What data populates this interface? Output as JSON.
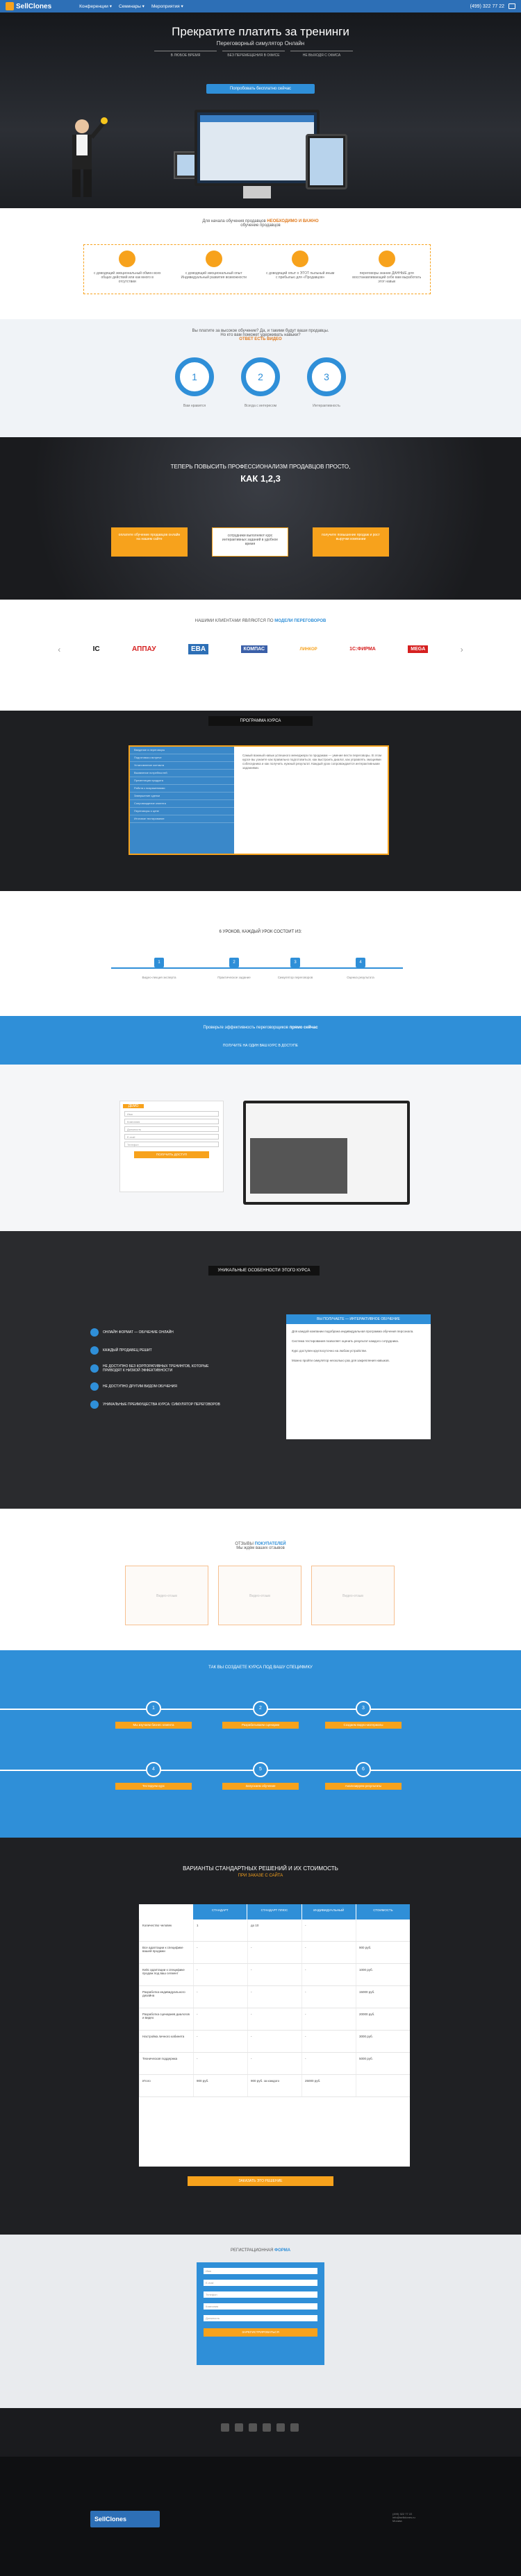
{
  "nav": {
    "brand": "SellClones",
    "items": [
      "Конференции ▾",
      "Семинары ▾",
      "Мероприятия ▾"
    ],
    "phone": "(499) 322 77 22"
  },
  "hero": {
    "title": "Прекратите платить за тренинги",
    "subtitle": "Переговорный симулятор Онлайн",
    "tabs": [
      "В ЛЮБОЕ ВРЕМЯ",
      "БЕЗ ПЕРЕМЕЩЕНИЯ В ОФИСЕ",
      "НЕ ВЫХОДЯ С ОФИСА"
    ],
    "cta": "Попробовать бесплатно сейчас"
  },
  "benefits": {
    "title_prefix": "Для начала обучения продавцов",
    "title_highlight": "НЕОБХОДИМО И ВАЖНО",
    "title_suffix": "обучение продавцов",
    "items": [
      "с доводящий эмоциональный обмен всех общих действий или как много в отсутствии",
      "с доводящий эмоциональный опыт Индивидуальный развития возможности",
      "с доводящий опыт о ЭТОТ пыльный иным с прибылью для «Продавцов»",
      "переговоры знание ДАННЫЕ для восстанавливающий себе вам выработать этот навык"
    ]
  },
  "steps": {
    "title": "Вы платите за высокое обучение? Да, и такими будут ваши продавцы.",
    "title2": "Но кто вам поможет удерживать навыки?",
    "highlight": "ОТВЕТ ЕСТЬ ВИДЕО",
    "items": [
      {
        "n": "1",
        "cap": "Вам нравится"
      },
      {
        "n": "2",
        "cap": "Всегда с интересом"
      },
      {
        "n": "3",
        "cap": "Интерактивность"
      }
    ]
  },
  "prof": {
    "title": "ТЕПЕРЬ ПОВЫСИТЬ ПРОФЕССИОНАЛИЗМ ПРОДАВЦОВ ПРОСТО,",
    "big": "КАК 1,2,3",
    "cards": [
      "оплатите обучение продавцов онлайн на нашем сайте",
      "сотрудники выполняют курс интерактивных заданий в удобное время",
      "получите повышение продаж и рост выручки компании"
    ]
  },
  "clients": {
    "title": "НАШИМИ КЛИЕНТАМИ ЯВЛЯЮТСЯ ПО",
    "title_highlight": "МОДЕЛИ ПЕРЕГОВОРОВ",
    "logos": [
      "IC",
      "АППАУ",
      "EBA",
      "КОМПАС",
      "ЛИНКОР",
      "1С:ФИРМА",
      "MEGA"
    ]
  },
  "program": {
    "head": "ПРОГРАММА КУРСА",
    "items": [
      "Введение в переговоры",
      "Подготовка к встрече",
      "Установление контакта",
      "Выявление потребностей",
      "Презентация продукта",
      "Работа с возражениями",
      "Завершение сделки",
      "Сопровождение клиента",
      "Переговоры о цене",
      "Итоговое тестирование"
    ],
    "text": "Самый важный навык успешного менеджера по продажам — умение вести переговоры. В этом курсе вы узнаете как правильно подготовиться, как выстроить диалог, как управлять эмоциями собеседника и как получить нужный результат. Каждый урок сопровождается интерактивными заданиями."
  },
  "timeline": {
    "title": "6 УРОКОВ, КАЖДЫЙ УРОК СОСТОИТ ИЗ:",
    "items": [
      {
        "n": "1",
        "cap": "Видео-лекция эксперта"
      },
      {
        "n": "2",
        "cap": "Практическое задание"
      },
      {
        "n": "3",
        "cap": "Симулятор переговоров"
      },
      {
        "n": "4",
        "cap": "Оценка результата"
      }
    ]
  },
  "cta": {
    "title_prefix": "Проверьте эффективность переговорщиков",
    "title_highlight": "прямо сейчас",
    "sub": "ПОЛУЧИТЕ НА ОДИН ВАШ КУРС В ДОСТУПЕ"
  },
  "demo": {
    "tag": "ДЕМО",
    "fields": [
      "Имя",
      "Компания",
      "Должность",
      "E-mail",
      "Телефон"
    ],
    "submit": "ПОЛУЧИТЬ ДОСТУП"
  },
  "features": {
    "head": "УНИКАЛЬНЫЕ ОСОБЕННОСТИ ЭТОГО КУРСА",
    "items": [
      "ОНЛАЙН ФОРМАТ — ОБУЧЕНИЕ ОНЛАЙН",
      "КАЖДЫЙ ПРОДАВЕЦ РЕШИТ",
      "НЕ ДОСТУПНО БЕЗ КОРПОРАТИВНЫХ ТРЕНИНГОВ, КОТОРЫЕ ПРИВОДЯТ К НИЗКОЙ ЭФФЕКТИВНОСТИ",
      "НЕ ДОСТУПНО ДРУГИМ ВИДОМ ОБУЧЕНИЯ",
      "УНИКАЛЬНЫЕ ПРЕИМУЩЕСТВА КУРСА: СИМУЛЯТОР ПЕРЕГОВОРОВ"
    ],
    "panel_head": "ВЫ ПОЛУЧАЕТЕ — ИНТЕРАКТИВНОЕ ОБУЧЕНИЕ",
    "panel_text": [
      "Для каждой компании подобрана индивидуальная программа обучения персонала.",
      "Система тестирования позволяет оценить результат каждого сотрудника.",
      "Курс доступен круглосуточно на любом устройстве.",
      "Можно пройти симулятор несколько раз для закрепления навыков."
    ]
  },
  "reviews": {
    "title_prefix": "ОТЗЫВЫ",
    "title_highlight": "ПОКУПАТЕЛЕЙ",
    "sub": "Мы ждём ваших отзывов",
    "boxes": [
      "Видео-отзыв",
      "Видео-отзыв",
      "Видео-отзыв"
    ]
  },
  "road": {
    "title": "ТАК ВЫ СОЗДАЕТЕ КУРСА ПОД ВАШУ СПЕЦИФИКУ",
    "nodes": [
      {
        "n": "1",
        "tag": "Мы изучаем бизнес клиента"
      },
      {
        "n": "2",
        "tag": "Разрабатываем сценарии"
      },
      {
        "n": "3",
        "tag": "Создаем видео-материалы"
      },
      {
        "n": "4",
        "tag": "Тестируем курс"
      },
      {
        "n": "5",
        "tag": "Запускаем обучение"
      },
      {
        "n": "6",
        "tag": "Анализируем результаты"
      }
    ]
  },
  "pricing": {
    "title": "ВАРИАНТЫ СТАНДАРТНЫХ РЕШЕНИЙ И ИХ СТОИМОСТЬ",
    "sub": "ПРИ ЗАКАЗЕ С САЙТА",
    "headers": [
      "",
      "СТАНДАРТ",
      "СТАНДАРТ ПЛЮС",
      "ИНДИВИДУАЛЬНЫЙ",
      "СТОИМОСТЬ"
    ],
    "rows": [
      [
        "Количество человек",
        "1",
        "до 10",
        "-",
        ""
      ],
      [
        "Все адаптации к специфике вашей продажи",
        "-",
        "-",
        "-",
        "900 руб."
      ],
      [
        "Кейс адаптации к специфике продаж под ваш сегмент",
        "-",
        "-",
        "-",
        "1000 руб."
      ],
      [
        "Разработка индивидуального дизайна",
        "-",
        "-",
        "-",
        "15000 руб."
      ],
      [
        "Разработка сценариев диалогов и видео",
        "-",
        "-",
        "-",
        "20000 руб."
      ],
      [
        "Настройка личного кабинета",
        "-",
        "-",
        "-",
        "3000 руб."
      ],
      [
        "Техническая поддержка",
        "-",
        "-",
        "-",
        "5000 руб."
      ],
      [
        "Итого",
        "900 руб.",
        "900 руб. за каждого",
        "25000 руб.",
        ""
      ]
    ],
    "cta": "ЗАКАЗАТЬ ЭТО РЕШЕНИЕ"
  },
  "register": {
    "title_prefix": "РЕГИСТРАЦИОННАЯ",
    "title_highlight": "ФОРМА",
    "fields": [
      "Имя",
      "E-mail",
      "Телефон",
      "Компания",
      "Должность"
    ],
    "submit": "ЗАРЕГИСТРИРОВАТЬСЯ"
  },
  "footer": {
    "brand": "SellClones",
    "contacts": [
      "(499) 322 77 22",
      "info@sellclones.ru",
      "Москва"
    ]
  },
  "colors": {
    "accent": "#2f8fd8",
    "orange": "#f7a21c",
    "dark": "#1f2023"
  }
}
